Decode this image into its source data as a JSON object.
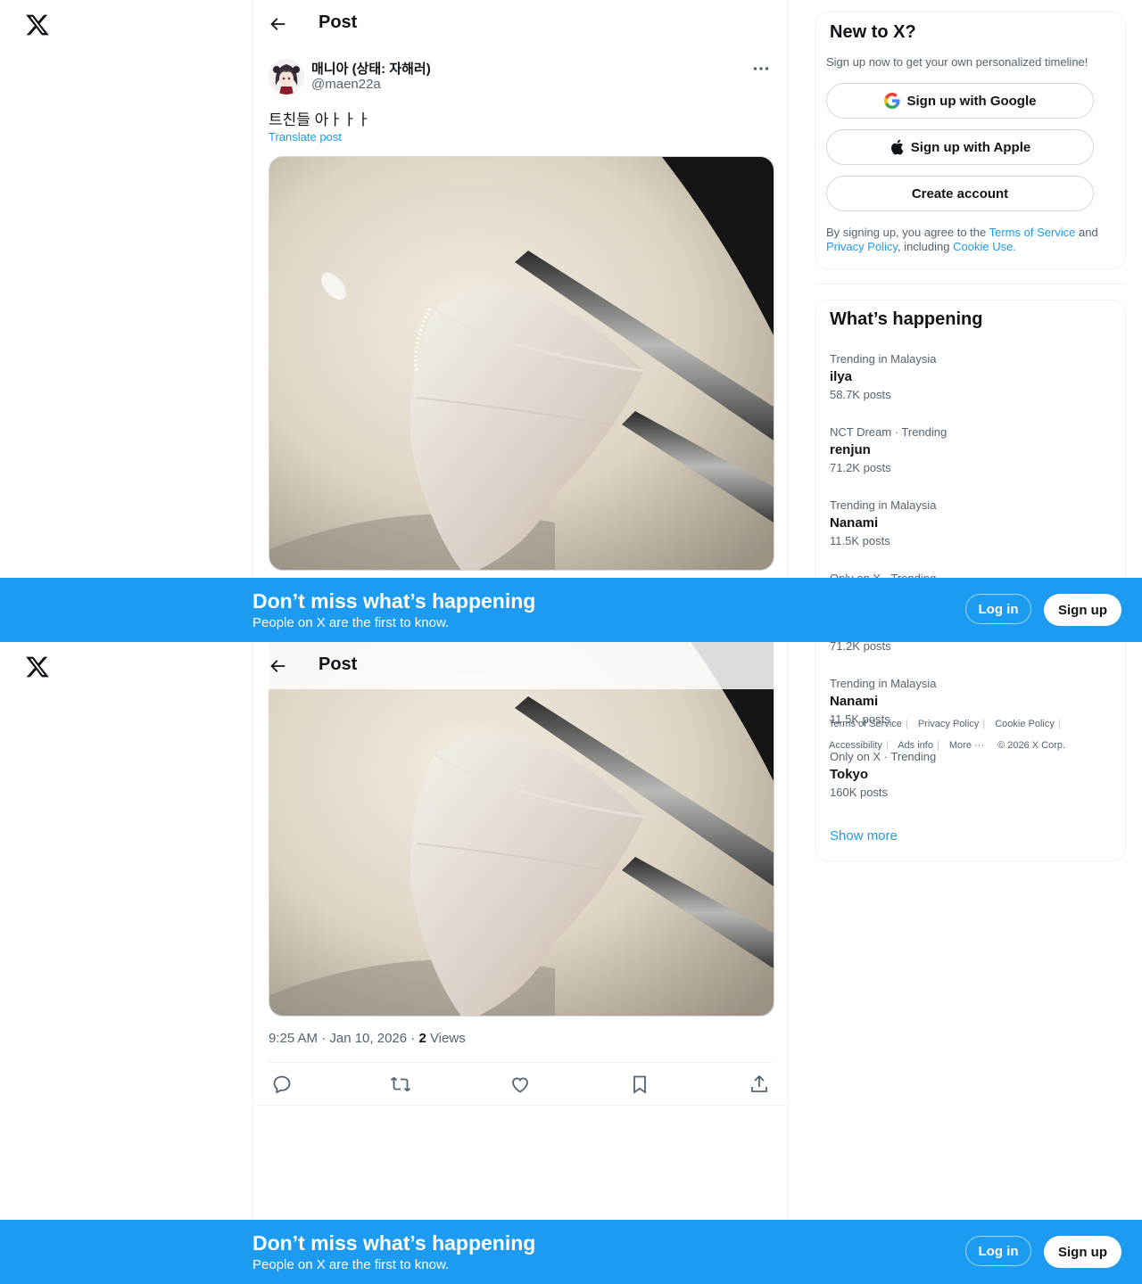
{
  "app": {
    "logo": "x-logo-icon"
  },
  "header": {
    "title": "Post",
    "back_icon": "arrow-left-icon"
  },
  "post": {
    "display_name": "매니아 (상태: 자해러)",
    "handle": "@maen22a",
    "text": "트친들 아ㅏㅏㅏ",
    "translate_label": "Translate post",
    "time": "9:25 AM · Jan 10, 2026 · ",
    "views_count": "2",
    "views_label": " Views",
    "image_desc_icon": "photo-sashimi-chopsticks",
    "actions": [
      "reply-icon",
      "repost-icon",
      "like-icon",
      "bookmark-icon",
      "share-icon"
    ]
  },
  "signup": {
    "title": "New to X?",
    "subtitle": "Sign up now to get your own personalized timeline!",
    "google": "Sign up with Google",
    "apple": "Sign up with Apple",
    "create": "Create account",
    "legal_pre": "By signing up, you agree to the ",
    "terms": "Terms of Service",
    "and": " and",
    "privacy": "Privacy Policy",
    "including": ", including ",
    "cookie": "Cookie Use."
  },
  "trends": {
    "title": "What’s happening",
    "items": [
      {
        "context": "Trending in Malaysia",
        "name": "ilya",
        "count": "58.7K posts"
      },
      {
        "context": "NCT Dream · Trending",
        "name": "renjun",
        "count": "71.2K posts"
      },
      {
        "context": "Trending in Malaysia",
        "name": "Nanami",
        "count": "11.5K posts"
      },
      {
        "context": "Only on X · Trending",
        "name": "Tokyo",
        "count": "160K posts"
      }
    ],
    "show_more": "Show more"
  },
  "footer": {
    "links": [
      "Terms of Service",
      "Privacy Policy",
      "Cookie Policy",
      "Accessibility",
      "Ads info",
      "More ···"
    ],
    "copyright": "© 2026 X Corp."
  },
  "banner": {
    "title": "Don’t miss what’s happening",
    "subtitle": "People on X are the first to know.",
    "login": "Log in",
    "signup": "Sign up"
  },
  "colors": {
    "accent": "#1d9bf0",
    "text": "#0f1419",
    "muted": "#536471"
  }
}
